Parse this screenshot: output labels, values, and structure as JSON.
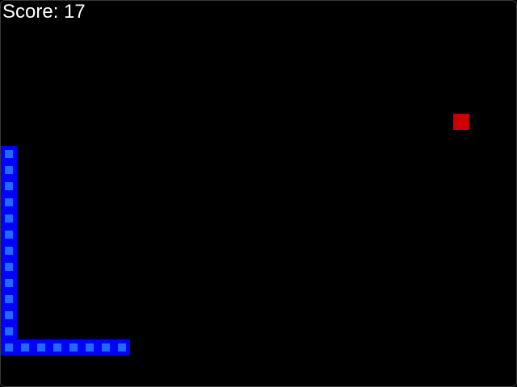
{
  "hud": {
    "score_text": "Score: 17",
    "score": 17
  },
  "colors": {
    "background": "#000000",
    "snake_outer": "#0000ff",
    "snake_inner": "#1e6cff",
    "food": "#cc0000",
    "text": "#ffffff"
  },
  "game": {
    "grid_columns": 32,
    "grid_rows": 24,
    "snake": [
      {
        "col": 7,
        "row": 21
      },
      {
        "col": 6,
        "row": 21
      },
      {
        "col": 5,
        "row": 21
      },
      {
        "col": 4,
        "row": 21
      },
      {
        "col": 3,
        "row": 21
      },
      {
        "col": 2,
        "row": 21
      },
      {
        "col": 1,
        "row": 21
      },
      {
        "col": 0,
        "row": 21
      },
      {
        "col": 0,
        "row": 20
      },
      {
        "col": 0,
        "row": 19
      },
      {
        "col": 0,
        "row": 18
      },
      {
        "col": 0,
        "row": 17
      },
      {
        "col": 0,
        "row": 16
      },
      {
        "col": 0,
        "row": 15
      },
      {
        "col": 0,
        "row": 14
      },
      {
        "col": 0,
        "row": 13
      },
      {
        "col": 0,
        "row": 12
      },
      {
        "col": 0,
        "row": 11
      },
      {
        "col": 0,
        "row": 10
      },
      {
        "col": 0,
        "row": 9
      }
    ],
    "food": {
      "col": 28,
      "row": 7
    }
  }
}
